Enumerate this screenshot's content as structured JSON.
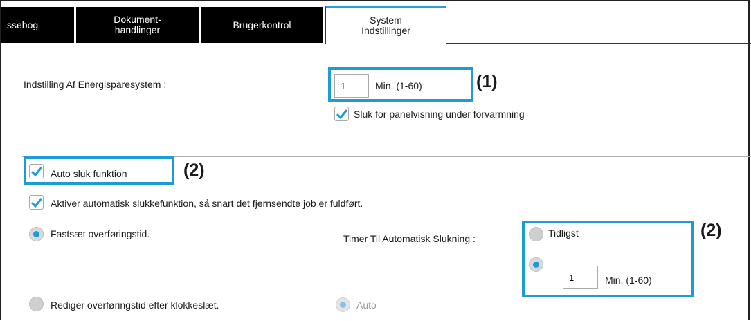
{
  "tabs": [
    {
      "label": "ssebog"
    },
    {
      "label": "Dokument-\nhandlinger"
    },
    {
      "label": "Brugerkontrol"
    },
    {
      "label": "System\nIndstillinger"
    }
  ],
  "energy": {
    "label": "Indstilling Af Energisparesystem :",
    "value": "1",
    "unit": "Min. (1-60)",
    "panel_off_label": "Sluk for panelvisning under forvarmning",
    "panel_off_checked": true
  },
  "auto_off": {
    "label": "Auto sluk funktion",
    "checked": true,
    "remote_label": "Aktiver automatisk slukkefunktion, så snart det fjernsendte job er fuldført.",
    "remote_checked": true,
    "fixed_label": "Fastsæt overføringstid.",
    "timer_label": "Timer Til Automatisk Slukning :",
    "earliest_label": "Tidligst",
    "timer_value": "1",
    "timer_unit": "Min. (1-60)",
    "edit_label": "Rediger overføringstid efter klokkeslæt.",
    "auto_label": "Auto"
  },
  "callouts": {
    "one": "(1)",
    "two": "(2)",
    "three": "(2)"
  },
  "colors": {
    "highlight": "#1e9bd7",
    "check": "#1e9bd7"
  }
}
